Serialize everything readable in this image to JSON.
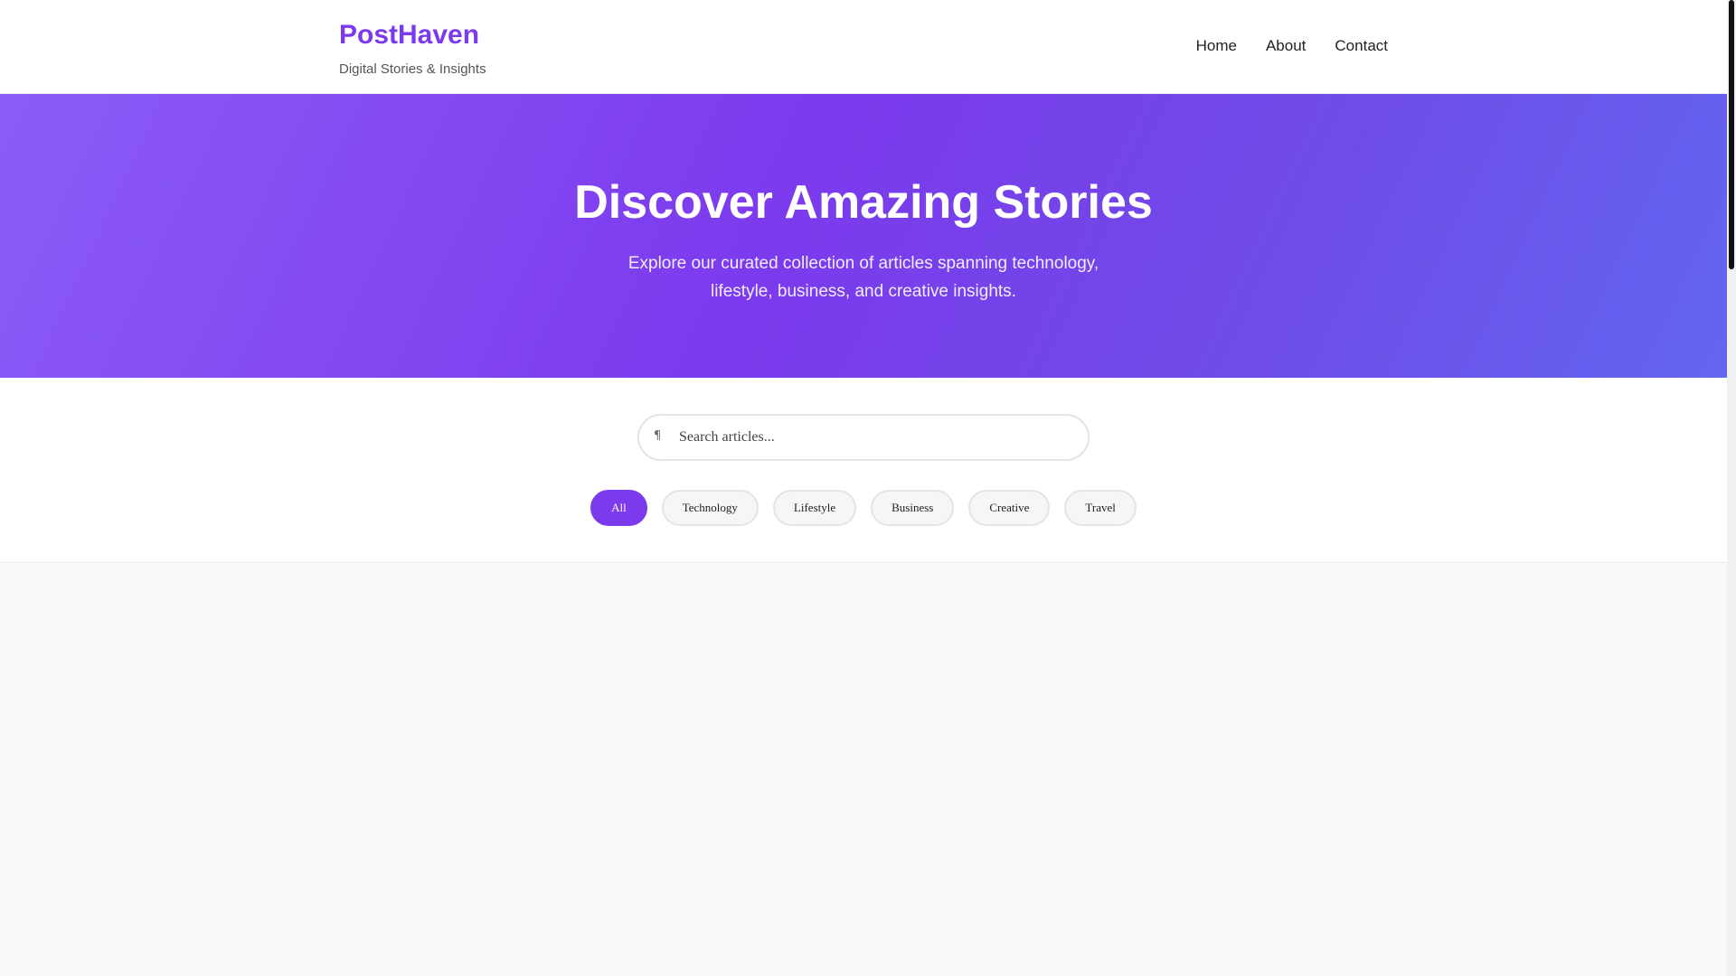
{
  "header": {
    "brand": "PostHaven",
    "tagline": "Digital Stories & Insights",
    "nav": [
      "Home",
      "About",
      "Contact"
    ]
  },
  "hero": {
    "title": "Discover Amazing Stories",
    "subtitle": "Explore our curated collection of articles spanning technology, lifestyle, business, and creative insights."
  },
  "search": {
    "placeholder": "Search articles...",
    "value": "",
    "icon": "search-icon"
  },
  "filters": {
    "active": "All",
    "items": [
      "All",
      "Technology",
      "Lifestyle",
      "Business",
      "Creative",
      "Travel"
    ]
  },
  "colors": {
    "accent": "#7c3aed",
    "hero_gradient_start": "#8b5cf6",
    "hero_gradient_end": "#6366f1",
    "page_background": "#f9f9f9"
  }
}
